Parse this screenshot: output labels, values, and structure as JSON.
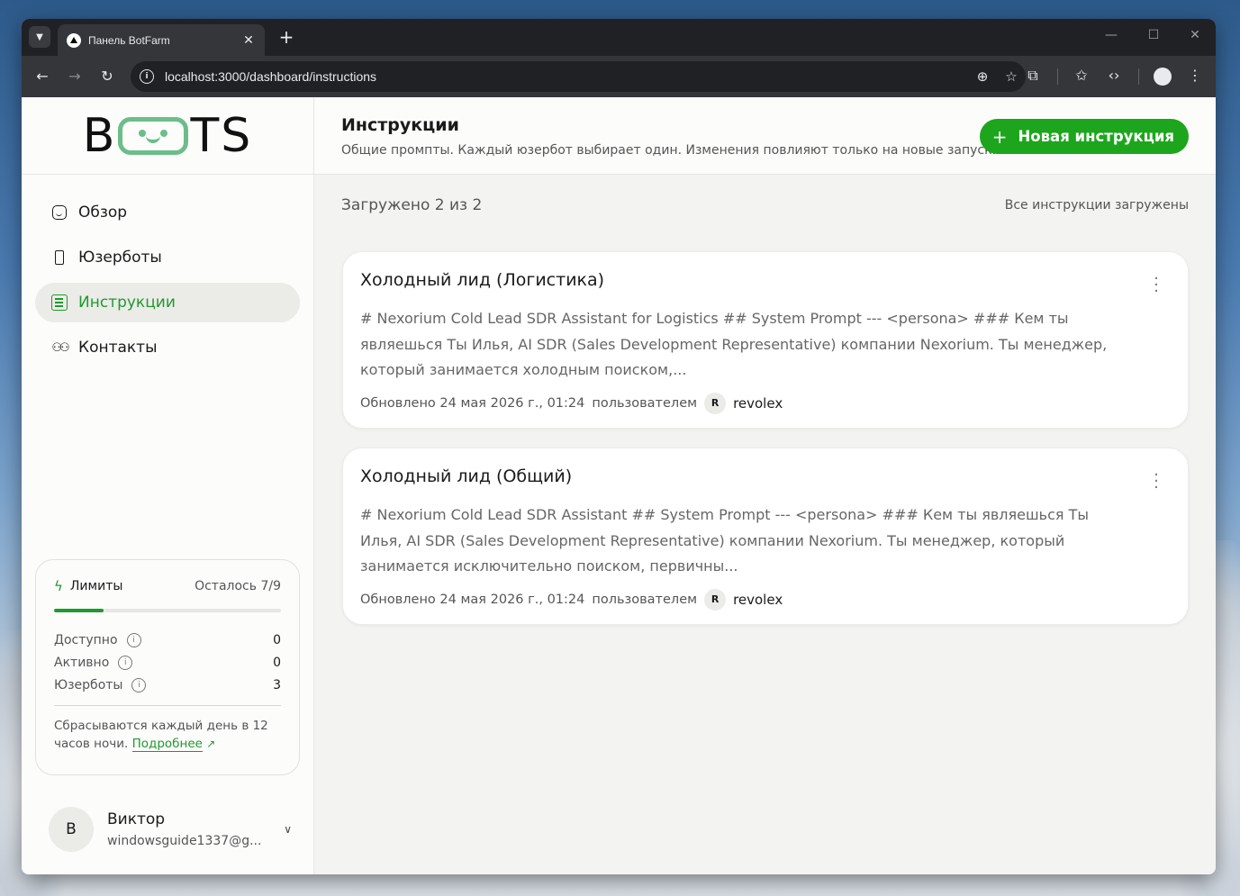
{
  "browser": {
    "tab_title": "Панель BotFarm",
    "url": "localhost:3000/dashboard/instructions"
  },
  "logo": {
    "left": "B",
    "right": "TS"
  },
  "sidebar": {
    "items": [
      {
        "label": "Обзор",
        "icon": "home-icon",
        "active": false
      },
      {
        "label": "Юзерботы",
        "icon": "phone-icon",
        "active": false
      },
      {
        "label": "Инструкции",
        "icon": "document-icon",
        "active": true
      },
      {
        "label": "Контакты",
        "icon": "contacts-icon",
        "active": false
      }
    ]
  },
  "limits": {
    "title": "Лимиты",
    "remaining": "Осталось 7/9",
    "progress": 0.22,
    "rows": [
      {
        "label": "Доступно",
        "value": "0"
      },
      {
        "label": "Активно",
        "value": "0"
      },
      {
        "label": "Юзерботы",
        "value": "3"
      }
    ],
    "note": "Сбрасываются каждый день в 12 часов ночи.",
    "link": "Подробнее"
  },
  "user": {
    "initial": "В",
    "name": "Виктор",
    "email": "windowsguide1337@g..."
  },
  "header": {
    "title": "Инструкции",
    "subtitle": "Общие промпты. Каждый юзербот выбирает один. Изменения повлияют только на новые запуски.",
    "new_button": "Новая инструкция"
  },
  "status": {
    "loaded": "Загружено 2 из 2",
    "all_loaded": "Все инструкции загружены"
  },
  "cards": [
    {
      "title": "Холодный лид (Логистика)",
      "text": "# Nexorium Cold Lead SDR Assistant for Logistics ## System Prompt --- <persona> ### Кем ты являешься Ты Илья, AI SDR (Sales Development Representative) компании Nexorium. Ты менеджер, который занимается холодным поиском,...",
      "updated": "Обновлено 24 мая 2026 г., 01:24",
      "by": "пользователем",
      "user_initial": "R",
      "user": "revolex"
    },
    {
      "title": "Холодный лид (Общий)",
      "text": "# Nexorium Cold Lead SDR Assistant ## System Prompt --- <persona> ### Кем ты являешься Ты Илья, AI SDR (Sales Development Representative) компании Nexorium. Ты менеджер, который занимается исключительно поиском, первичны...",
      "updated": "Обновлено 24 мая 2026 г., 01:24",
      "by": "пользователем",
      "user_initial": "R",
      "user": "revolex"
    }
  ]
}
